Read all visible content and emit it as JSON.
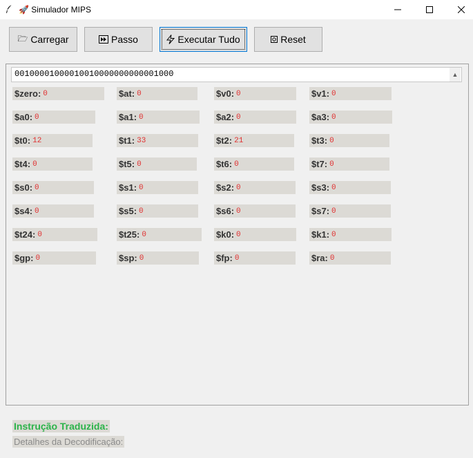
{
  "window": {
    "title": "🚀 Simulador MIPS"
  },
  "toolbar": {
    "load_label": "Carregar",
    "step_label": "Passo",
    "run_label": "Executar Tudo",
    "reset_label": "Reset"
  },
  "instruction": {
    "value": "00100001000010010000000000001000"
  },
  "registers": [
    {
      "name": "$zero:",
      "value": "0"
    },
    {
      "name": "$at:",
      "value": "0"
    },
    {
      "name": "$v0:",
      "value": "0"
    },
    {
      "name": "$v1:",
      "value": "0"
    },
    {
      "name": "$a0:",
      "value": "0"
    },
    {
      "name": "$a1:",
      "value": "0"
    },
    {
      "name": "$a2:",
      "value": "0"
    },
    {
      "name": "$a3:",
      "value": "0"
    },
    {
      "name": "$t0:",
      "value": "12"
    },
    {
      "name": "$t1:",
      "value": "33"
    },
    {
      "name": "$t2:",
      "value": "21"
    },
    {
      "name": "$t3:",
      "value": "0"
    },
    {
      "name": "$t4:",
      "value": "0"
    },
    {
      "name": "$t5:",
      "value": "0"
    },
    {
      "name": "$t6:",
      "value": "0"
    },
    {
      "name": "$t7:",
      "value": "0"
    },
    {
      "name": "$s0:",
      "value": "0"
    },
    {
      "name": "$s1:",
      "value": "0"
    },
    {
      "name": "$s2:",
      "value": "0"
    },
    {
      "name": "$s3:",
      "value": "0"
    },
    {
      "name": "$s4:",
      "value": "0"
    },
    {
      "name": "$s5:",
      "value": "0"
    },
    {
      "name": "$s6:",
      "value": "0"
    },
    {
      "name": "$s7:",
      "value": "0"
    },
    {
      "name": "$t24:",
      "value": "0"
    },
    {
      "name": "$t25:",
      "value": "0"
    },
    {
      "name": "$k0:",
      "value": "0"
    },
    {
      "name": "$k1:",
      "value": "0"
    },
    {
      "name": "$gp:",
      "value": "0"
    },
    {
      "name": "$sp:",
      "value": "0"
    },
    {
      "name": "$fp:",
      "value": "0"
    },
    {
      "name": "$ra:",
      "value": "0"
    }
  ],
  "footer": {
    "title": "Instrução Traduzida:",
    "details": "Detalhes da Decodificação:"
  }
}
